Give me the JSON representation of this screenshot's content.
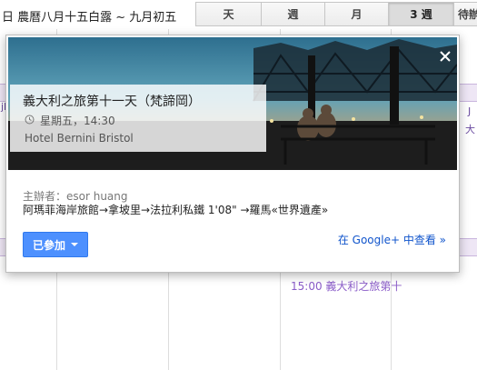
{
  "header": {
    "date_range": "日 農曆八月十五白露 ~ 九月初五",
    "views": [
      {
        "label": "天",
        "active": false
      },
      {
        "label": "週",
        "active": false
      },
      {
        "label": "月",
        "active": false
      },
      {
        "label": "3 週",
        "active": true
      },
      {
        "label": "待辦",
        "active": false
      }
    ]
  },
  "calendar": {
    "left_event_snippets": [
      "jb",
      "J",
      "大"
    ],
    "bottom_event": "15:00 義大利之旅第十"
  },
  "popup": {
    "title": "義大利之旅第十一天（梵諦岡）",
    "time": "星期五，14:30",
    "location": "Hotel Bernini Bristol",
    "organizer": "主辦者：esor huang",
    "description": "阿瑪菲海岸旅館→拿坡里→法拉利私鐵 1'08\" →羅馬«世界遺產»",
    "attend_label": "已參加",
    "gplus_link": "在 Google+ 中查看 »"
  },
  "colors": {
    "accent_blue": "#4d90fe",
    "link_blue": "#1155cc",
    "event_purple": "#8a5cc8"
  }
}
